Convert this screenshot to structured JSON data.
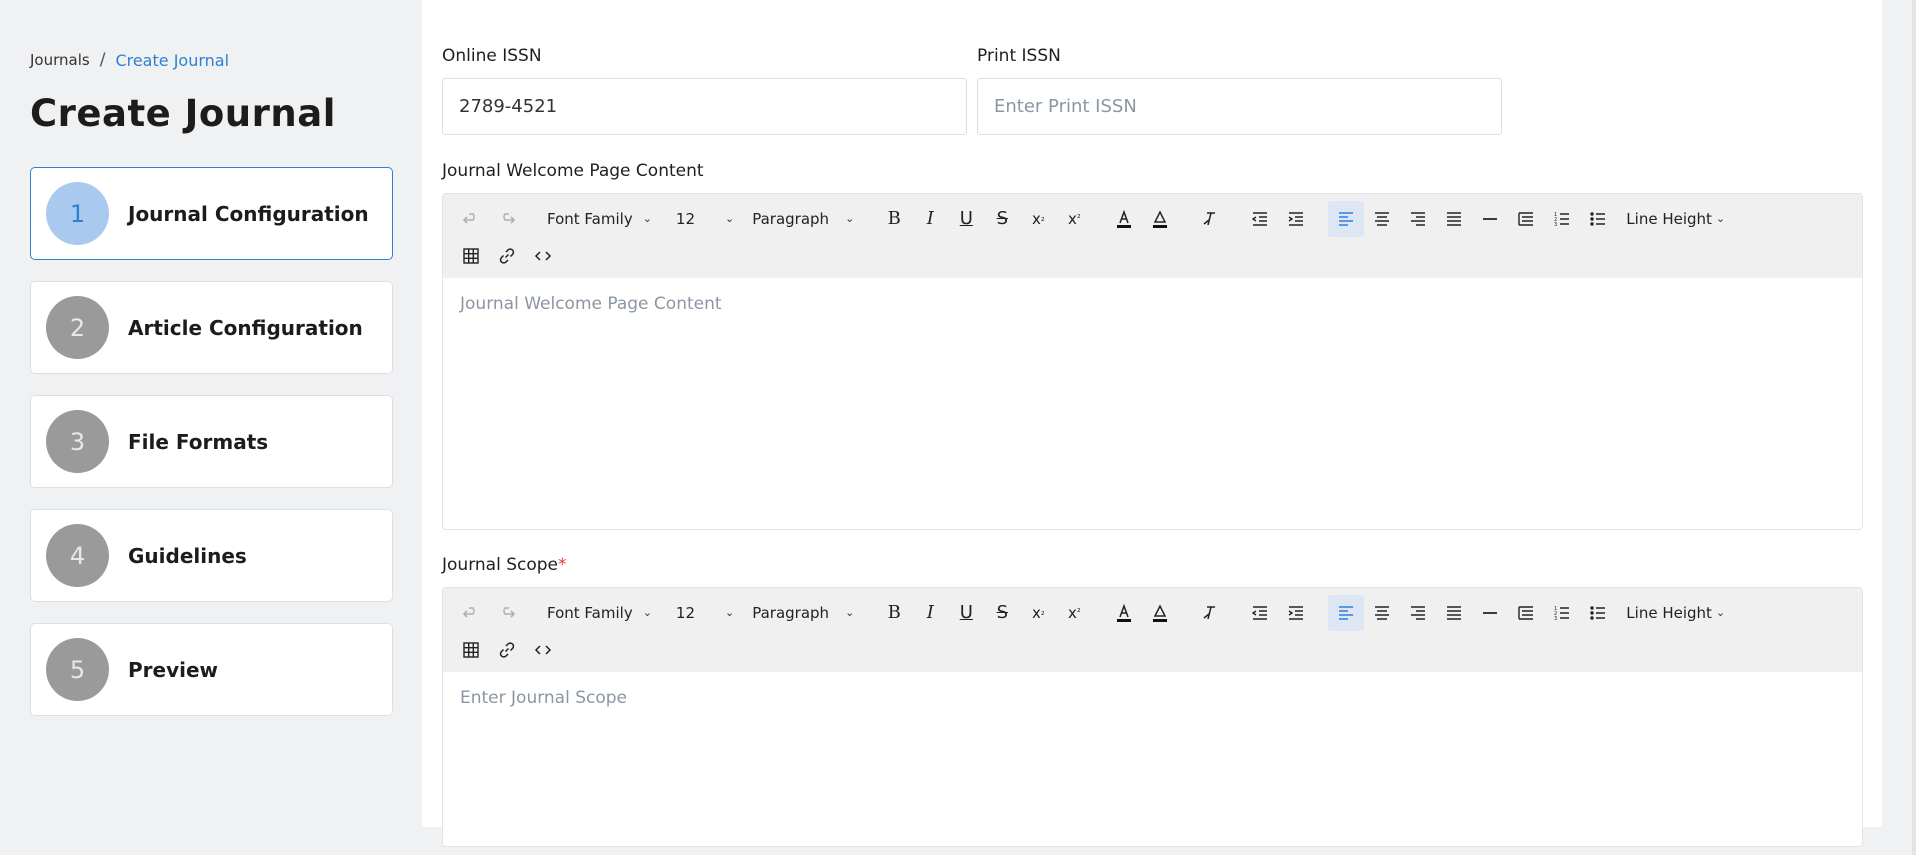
{
  "breadcrumb": {
    "root": "Journals",
    "separator": "/",
    "current": "Create Journal"
  },
  "page_title": "Create Journal",
  "steps": [
    {
      "number": "1",
      "label": "Journal Configuration",
      "active": true
    },
    {
      "number": "2",
      "label": "Article Configuration",
      "active": false
    },
    {
      "number": "3",
      "label": "File Formats",
      "active": false
    },
    {
      "number": "4",
      "label": "Guidelines",
      "active": false
    },
    {
      "number": "5",
      "label": "Preview",
      "active": false
    }
  ],
  "form": {
    "online_issn": {
      "label": "Online ISSN",
      "value": "2789-4521"
    },
    "print_issn": {
      "label": "Print ISSN",
      "placeholder": "Enter Print ISSN"
    },
    "welcome": {
      "label": "Journal Welcome Page Content",
      "placeholder": "Journal Welcome Page Content"
    },
    "scope": {
      "label": "Journal Scope",
      "required_mark": "*",
      "placeholder": "Enter Journal Scope"
    }
  },
  "toolbar": {
    "font_family": "Font Family",
    "font_size": "12",
    "block_format": "Paragraph",
    "line_height": "Line Height",
    "icons": [
      "undo-icon",
      "redo-icon",
      "bold-icon",
      "italic-icon",
      "underline-icon",
      "strikethrough-icon",
      "subscript-icon",
      "superscript-icon",
      "text-color-icon",
      "highlight-color-icon",
      "clear-format-icon",
      "outdent-icon",
      "indent-icon",
      "align-left-icon",
      "align-center-icon",
      "align-right-icon",
      "align-justify-icon",
      "horizontal-rule-icon",
      "list-style-icon",
      "numbered-list-icon",
      "bullet-list-icon",
      "table-icon",
      "link-icon",
      "code-icon"
    ]
  },
  "colors": {
    "accent": "#2f80d4",
    "step_inactive": "#9a9a9a",
    "step_active_bg": "#a9c9ee",
    "required": "#e53935"
  }
}
